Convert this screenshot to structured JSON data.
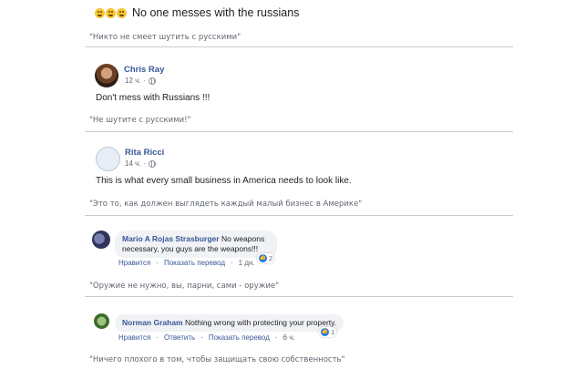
{
  "comments": {
    "top": {
      "emoji_icons": [
        "laughing-face-icon",
        "laughing-face-icon",
        "laughing-face-icon"
      ],
      "text": "No one messes with the russians",
      "caption": "\"Никто не смеет шутить с русскими\""
    },
    "chris": {
      "author": "Chris Ray",
      "time": "12 ч.",
      "text": "Don't mess with Russians !!!",
      "caption": "\"Не шутите с русскими!\""
    },
    "rita": {
      "author": "Rita Ricci",
      "time": "14 ч.",
      "text": "This is what every small business in America needs to look like.",
      "caption": "\"Это то, как должен выглядеть каждый малый бизнес в Америке\""
    },
    "mario": {
      "author": "Mario A Rojas Strasburger",
      "text_line1": "No weapons",
      "text_line2": "necessary, you guys are the weapons!!!",
      "like": "Нравится",
      "translate": "Показать перевод",
      "time": "1 дн.",
      "reaction_count": "2",
      "caption": "\"Оружие не нужно, вы, парни, сами - оружие\""
    },
    "norman": {
      "author": "Norman Graham",
      "text": "Nothing wrong with protecting your property.",
      "like": "Нравится",
      "reply": "Ответить",
      "translate": "Показать перевод",
      "time": "6 ч.",
      "reaction_count": "1",
      "caption": "\"Ничего плохого в том, чтобы защищать свою собственность\""
    }
  }
}
